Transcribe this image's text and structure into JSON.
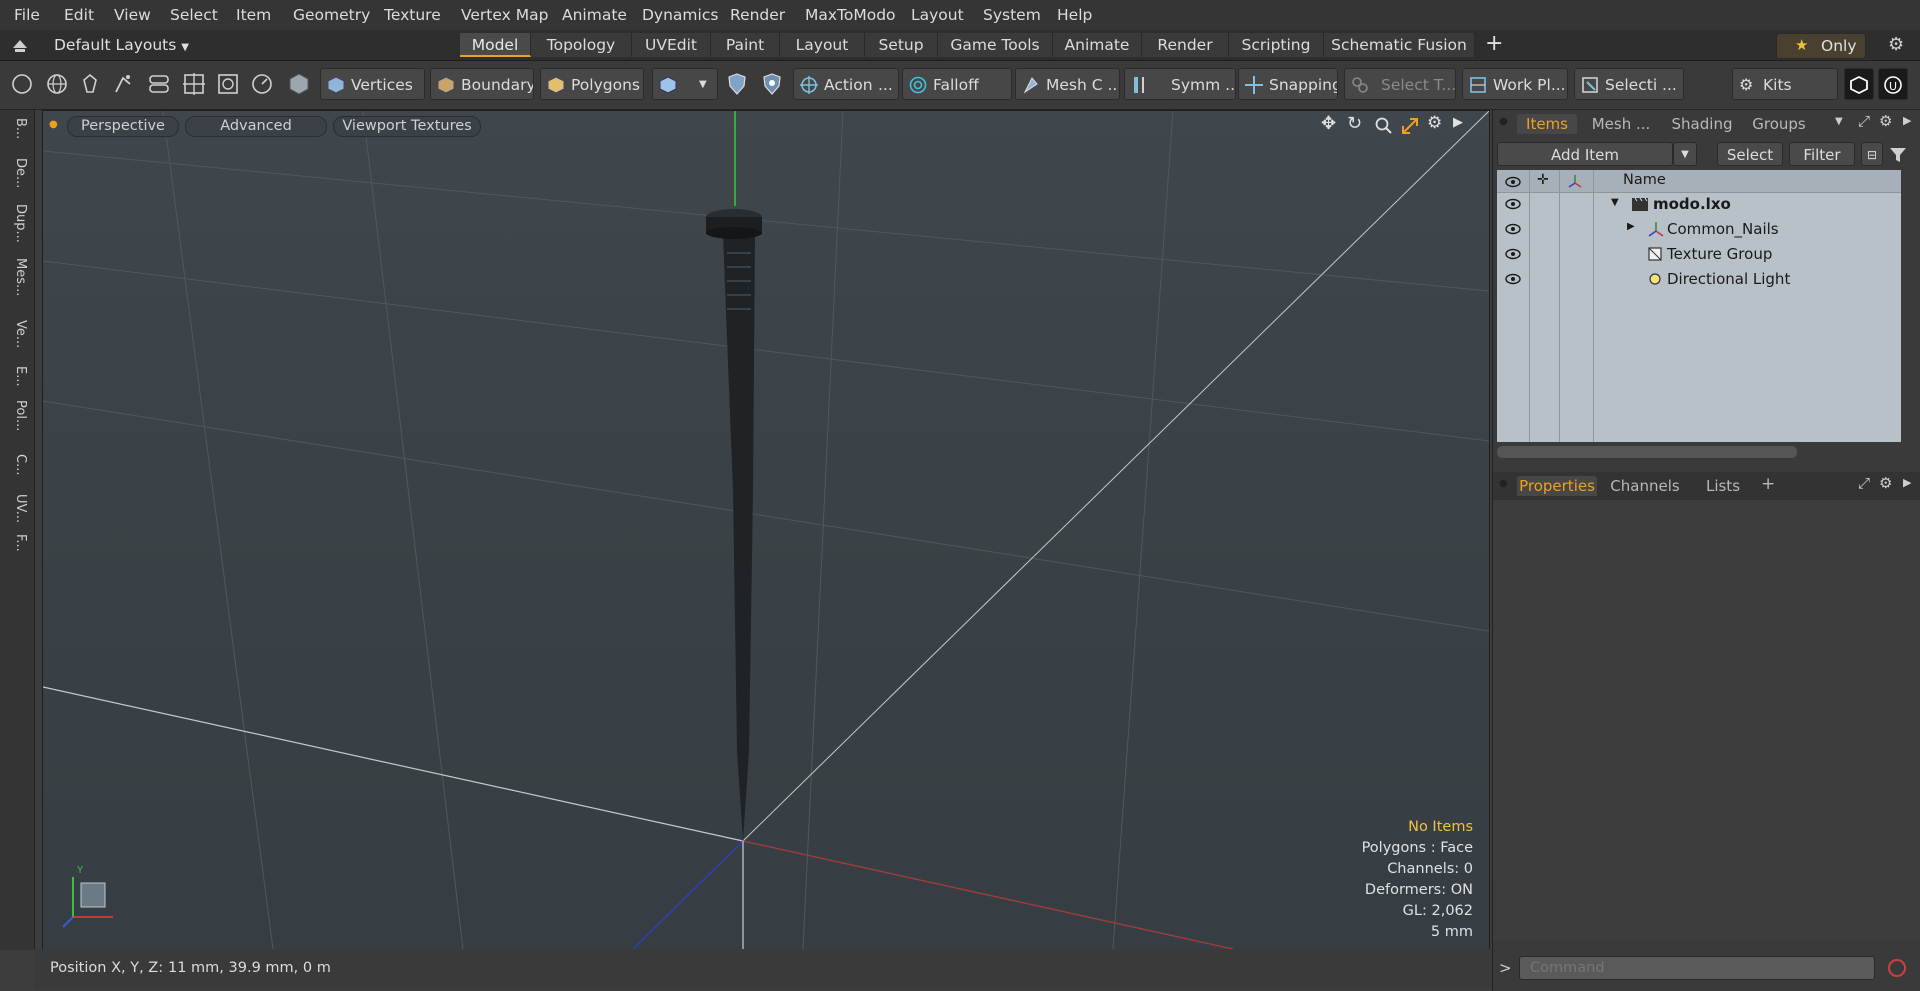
{
  "menu": [
    "File",
    "Edit",
    "View",
    "Select",
    "Item",
    "Geometry",
    "Texture",
    "Vertex Map",
    "Animate",
    "Dynamics",
    "Render",
    "MaxToModo",
    "Layout",
    "System",
    "Help"
  ],
  "layout": {
    "preset": "Default Layouts",
    "tabs": [
      "Model",
      "Topology",
      "UVEdit",
      "Paint",
      "Layout",
      "Setup",
      "Game Tools",
      "Animate",
      "Render",
      "Scripting",
      "Schematic Fusion"
    ],
    "active_tab": "Model",
    "add_symbol": "+",
    "only_label": "Only"
  },
  "toolbar": {
    "vertices": "Vertices",
    "boundary": "Boundary",
    "polygons": "Polygons",
    "action": "Action",
    "action_more": "...",
    "falloff": "Falloff",
    "mesh": "Mesh C ...",
    "symm": "Symm ...",
    "snapping": "Snapping",
    "select_t": "Select T...",
    "work_plane": "Work Pl...",
    "selection": "Selecti ...",
    "kits": "Kits"
  },
  "left_tabs": [
    "B...",
    "De...",
    "Dup...",
    "Mes...",
    "Ve...",
    "E...",
    "Pol...",
    "C...",
    "UV...",
    "F..."
  ],
  "viewport": {
    "buttons": [
      "Perspective",
      "Advanced",
      "Viewport Textures"
    ],
    "hud": {
      "selection": "No Items",
      "polygons": "Polygons : Face",
      "channels": "Channels: 0",
      "deformers": "Deformers: ON",
      "gl": "GL: 2,062",
      "scale": "5 mm"
    },
    "axis_y": "Y"
  },
  "status": {
    "label": "Position X, Y, Z:",
    "value": "11 mm, 39.9 mm, 0 m"
  },
  "items_panel": {
    "tabs": [
      "Items",
      "Mesh ...",
      "Shading",
      "Groups"
    ],
    "active_tab": "Items",
    "add_item": "Add Item",
    "select": "Select",
    "filter": "Filter",
    "column_name": "Name",
    "rows": [
      {
        "name": "modo.lxo",
        "bold": true
      },
      {
        "name": "Common_Nails"
      },
      {
        "name": "Texture Group"
      },
      {
        "name": "Directional Light"
      }
    ]
  },
  "properties_panel": {
    "tabs": [
      "Properties",
      "Channels",
      "Lists"
    ],
    "active_tab": "Properties",
    "add_symbol": "+"
  },
  "command": {
    "placeholder": "Command",
    "prompt": ">"
  },
  "colors": {
    "accent": "#f0a020",
    "viewport_top": "#3f474d",
    "item_list_bg": "#b9c1c8",
    "hud_highlight": "#f0c040"
  }
}
